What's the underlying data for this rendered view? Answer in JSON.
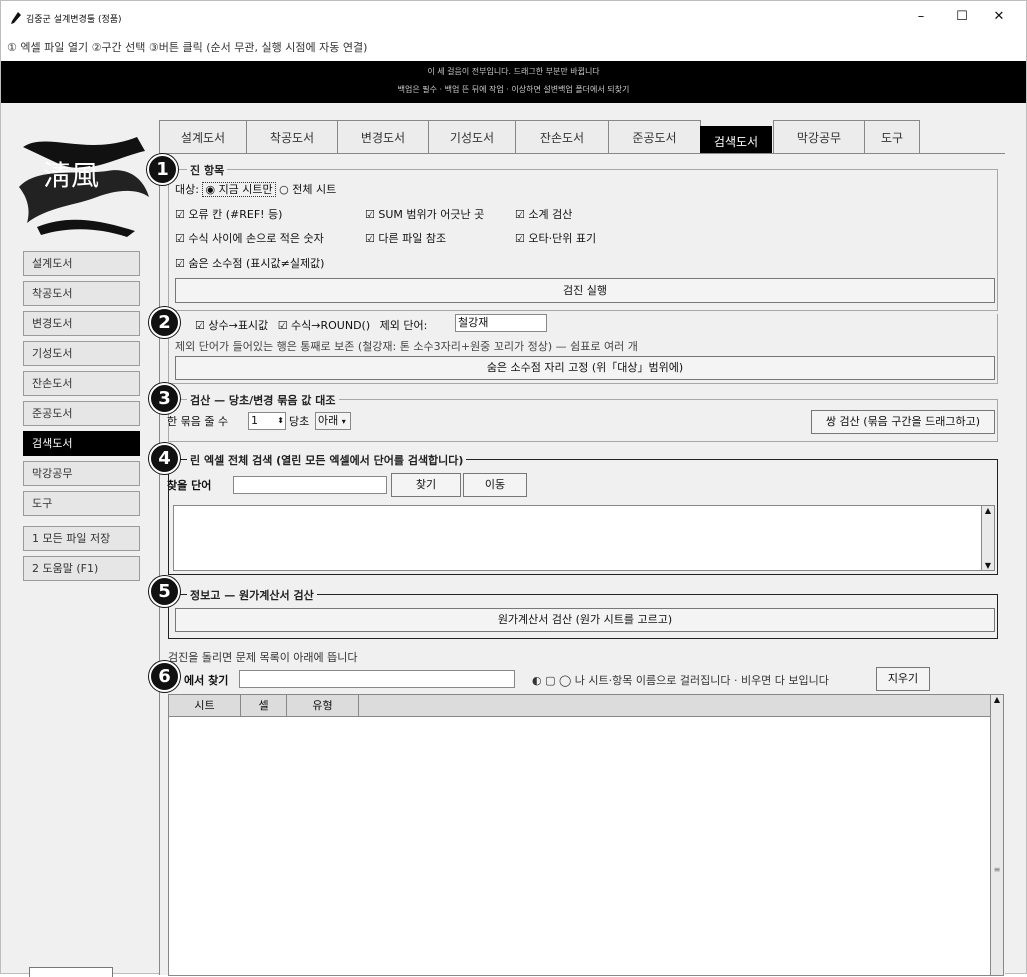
{
  "window": {
    "title": "김중군 설계변경툴 (정품)",
    "icon": "pencil-icon"
  },
  "steps_hint": "① 엑셀 파일 열기  ②구간 선택  ③버튼 클릭 (순서 무관, 실행 시점에 자동 연결)",
  "banner": {
    "line1": "이 세 걸음이 전부입니다. 드래그한 부분만 바뀝니다",
    "line2": "백업은 필수 · 백업 뜬 뒤에 작업 · 이상하면 설변백업 폴더에서 되찾기"
  },
  "logo": {
    "text": "淸風",
    "icon": "calligraphy-logo-icon"
  },
  "sidebar": {
    "items": [
      "설계도서",
      "착공도서",
      "변경도서",
      "기성도서",
      "잔손도서",
      "준공도서",
      "검색도서",
      "막강공무",
      "도구"
    ],
    "active": "검색도서",
    "actions": [
      "1 모든 파일 저장",
      "2 도움말 (F1)"
    ]
  },
  "tabs": [
    "설계도서",
    "착공도서",
    "변경도서",
    "기성도서",
    "잔손도서",
    "준공도서",
    "검색도서",
    "막강공무",
    "도구"
  ],
  "active_tab": "검색도서",
  "badges": [
    "1",
    "2",
    "3",
    "4",
    "5",
    "6"
  ],
  "section1": {
    "title": "진 항목",
    "target_label": "대상:",
    "opt_current": "지금 시트만",
    "opt_all": "전체 시트",
    "checks": [
      "오류 칸 (#REF! 등)",
      "SUM 범위가 어긋난 곳",
      "소계 검산",
      "수식 사이에 손으로 적은 숫자",
      "다른 파일 참조",
      "오타·단위 표기",
      "숨은 소수점 (표시값≠실제값)"
    ],
    "run_button": "검진 실행"
  },
  "section2": {
    "chk_const": "상수→표시값",
    "chk_round": "수식→ROUND()",
    "exclude_label": "제외 단어:",
    "exclude_value": "철강재",
    "note": "제외 단어가 들어있는 행은 통째로 보존 (철강재: 톤 소수3자리+원중 꼬리가 정상) — 쉼표로 여러 개",
    "button": "숨은 소수점 자리 고정 (위「대상」범위에)"
  },
  "section3": {
    "title": "검산 — 당초/변경 묶음 값 대조",
    "rows_label": "한 묶음 줄 수",
    "rows_value": "1",
    "orig_label": "당초",
    "orig_value": "아래",
    "button": "쌍 검산 (묶음 구간을 드래그하고)"
  },
  "section4": {
    "title": "린 엑셀 전체 검색 (열린 모든 엑셀에서 단어를 검색합니다)",
    "word_label": "찾을 단어",
    "word_value": "",
    "find_button": "찾기",
    "move_button": "이동"
  },
  "section5": {
    "title": "정보고 — 원가계산서 검산",
    "button": "원가계산서 검산 (원가 시트를 고르고)"
  },
  "section6": {
    "hint": "검진을 돌리면 문제 목록이 아래에 뜹니다",
    "search_label": "에서 찾기",
    "search_value": "",
    "filter_note": "◐ ▢ ◯ 나 시트·항목 이름으로 걸러집니다 · 비우면 다 보입니다",
    "clear_button": "지우기",
    "columns": [
      "시트",
      "셀",
      "유형"
    ]
  }
}
